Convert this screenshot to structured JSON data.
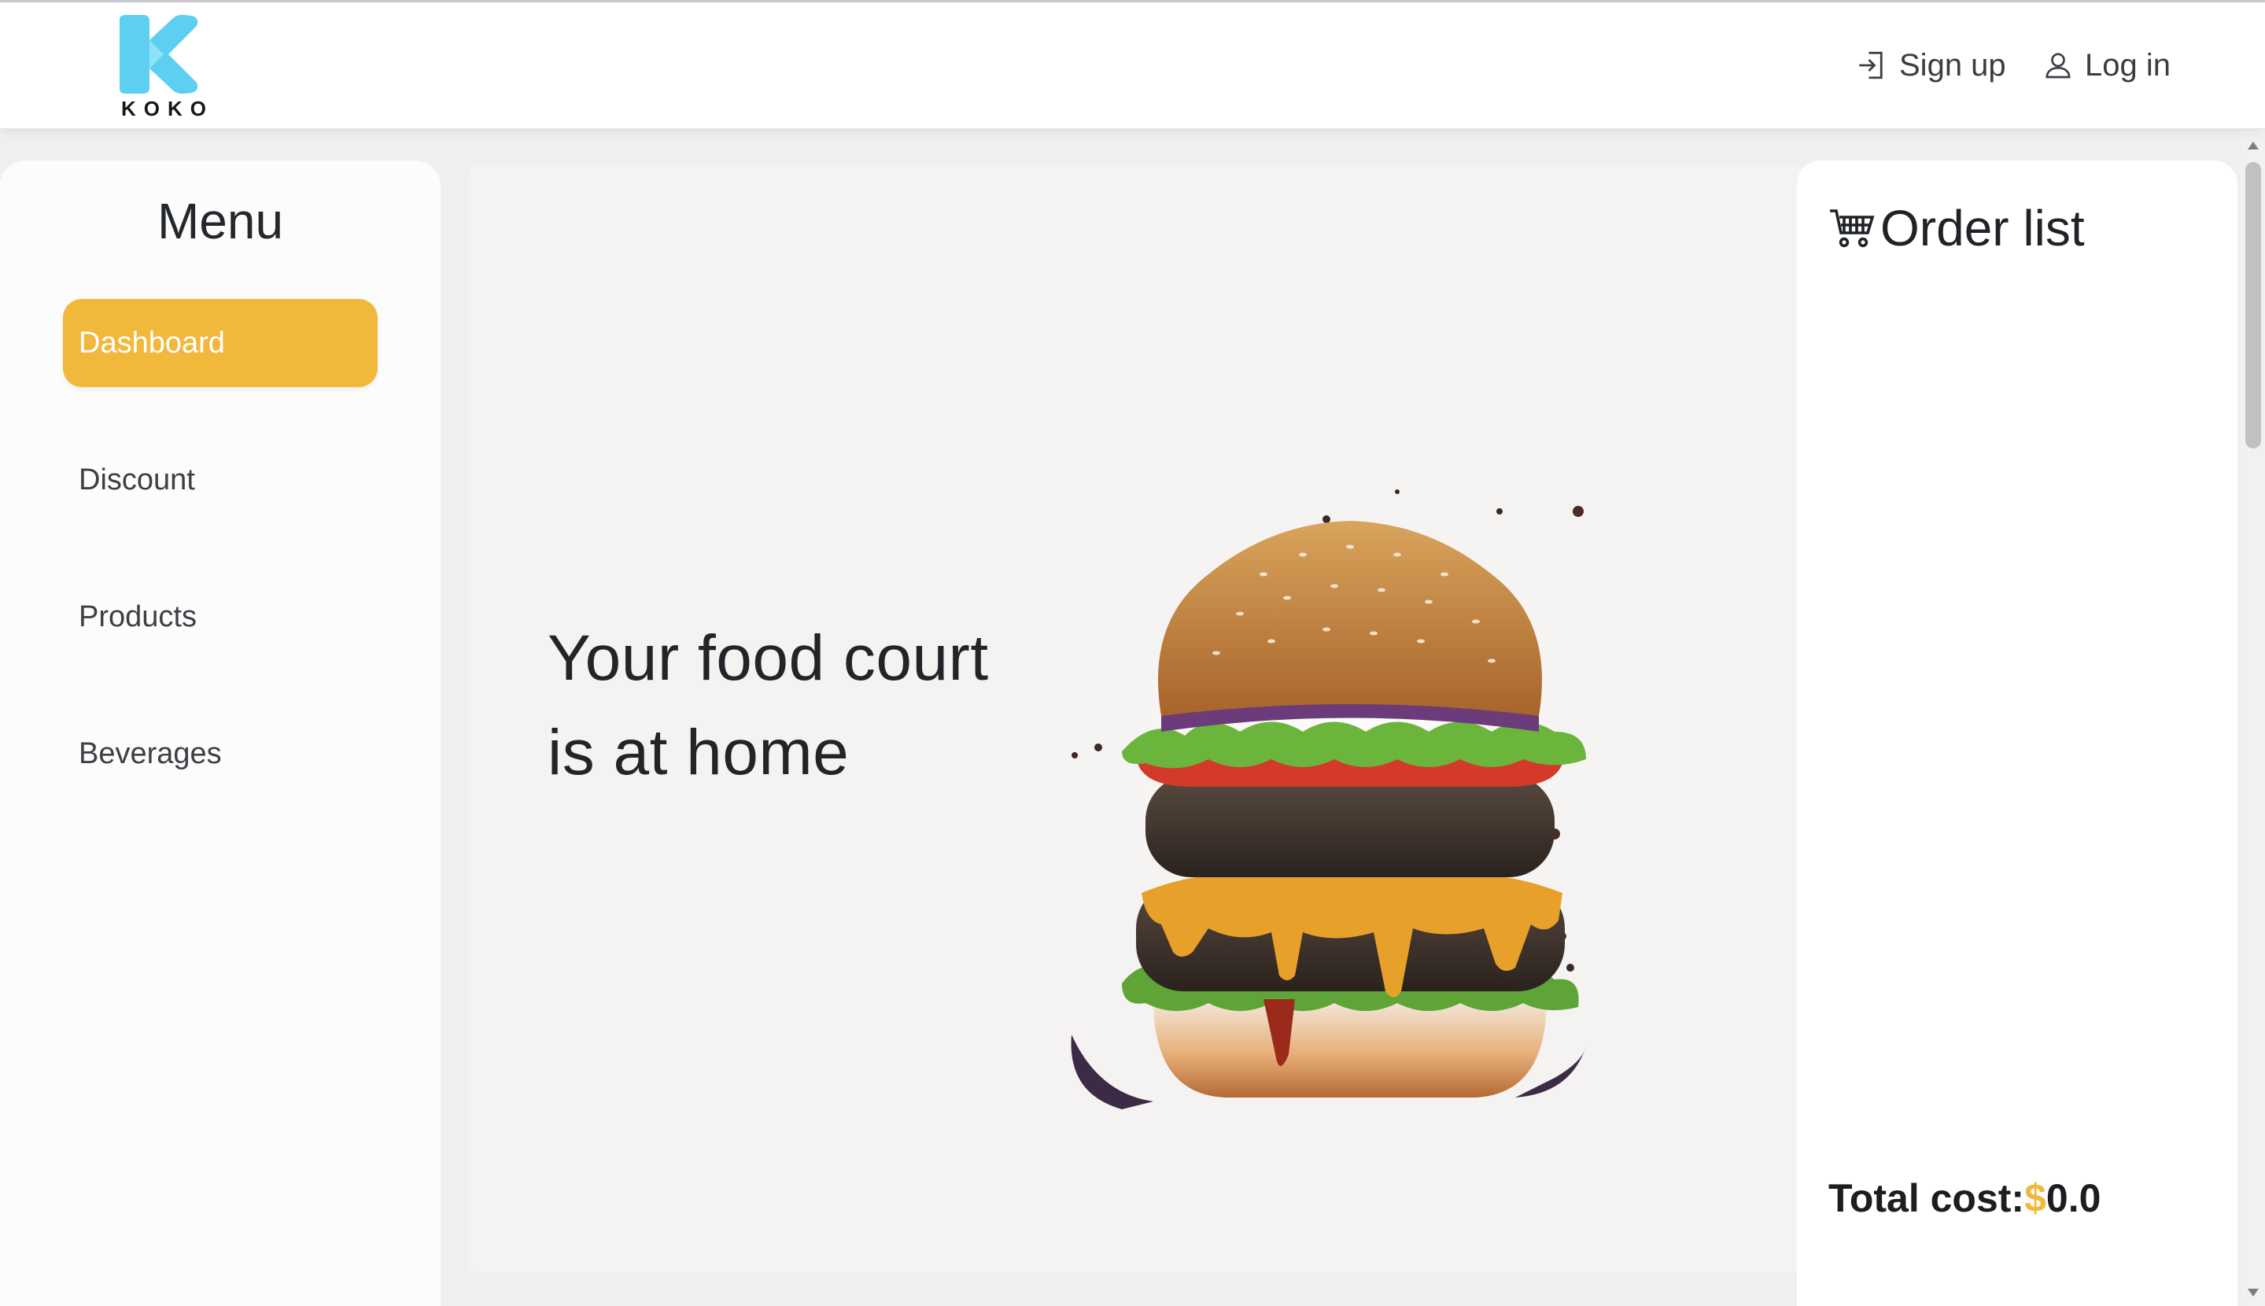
{
  "header": {
    "logo_text": "KOKO",
    "signup_label": "Sign up",
    "login_label": "Log in"
  },
  "sidebar": {
    "title": "Menu",
    "items": [
      {
        "label": "Dashboard",
        "active": true
      },
      {
        "label": "Discount",
        "active": false
      },
      {
        "label": "Products",
        "active": false
      },
      {
        "label": "Beverages",
        "active": false
      }
    ]
  },
  "hero": {
    "line1": "Your food court",
    "line2": "is at home"
  },
  "order": {
    "title": "Order list",
    "total_label": "Total cost:",
    "currency": "$",
    "total_value": "0.0"
  },
  "colors": {
    "accent": "#f1b83c",
    "logo": "#5ccff3"
  },
  "icons": [
    "login-arrow-icon",
    "user-icon",
    "shopping-cart-icon",
    "koko-logo"
  ]
}
